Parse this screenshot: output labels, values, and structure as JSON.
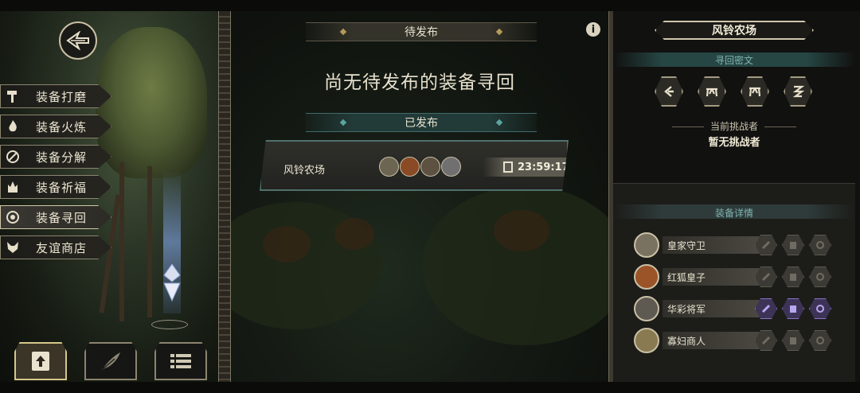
{
  "left_menu": {
    "items": [
      {
        "label": "装备打磨",
        "icon": "hammer-icon",
        "active": false
      },
      {
        "label": "装备火炼",
        "icon": "flame-icon",
        "active": false
      },
      {
        "label": "装备分解",
        "icon": "disassemble-icon",
        "active": false
      },
      {
        "label": "装备祈福",
        "icon": "blessing-icon",
        "active": false
      },
      {
        "label": "装备寻回",
        "icon": "retrieve-icon",
        "active": true
      },
      {
        "label": "友谊商店",
        "icon": "fox-icon",
        "active": false
      }
    ]
  },
  "bottom_tabs": [
    {
      "icon": "upload-icon",
      "active": true
    },
    {
      "icon": "feather-icon",
      "active": false
    },
    {
      "icon": "list-icon",
      "active": false
    }
  ],
  "center": {
    "pending_title": "待发布",
    "empty_message": "尚无待发布的装备寻回",
    "published_title": "已发布",
    "quest": {
      "name": "风铃农场",
      "timer": "23:59:17",
      "avatar_count": 4
    }
  },
  "right_panel": {
    "location_title": "风铃农场",
    "secret_heading": "寻回密文",
    "runes": [
      "rune-1-icon",
      "rune-2-icon",
      "rune-3-icon",
      "rune-4-icon"
    ],
    "challenger_label": "当前挑战者",
    "challenger_value": "暂无挑战者",
    "equip_heading": "装备详情",
    "equipment": [
      {
        "name": "皇家守卫",
        "slots_owned": [
          false,
          false,
          false
        ]
      },
      {
        "name": "红狐皇子",
        "slots_owned": [
          false,
          false,
          false
        ]
      },
      {
        "name": "华彩将军",
        "slots_owned": [
          true,
          true,
          true
        ]
      },
      {
        "name": "寡妇商人",
        "slots_owned": [
          false,
          false,
          false
        ]
      }
    ]
  },
  "colors": {
    "accent_gold": "#d6c78a",
    "accent_teal": "#5aa4a0",
    "owned_purple": "#8b74c9"
  }
}
